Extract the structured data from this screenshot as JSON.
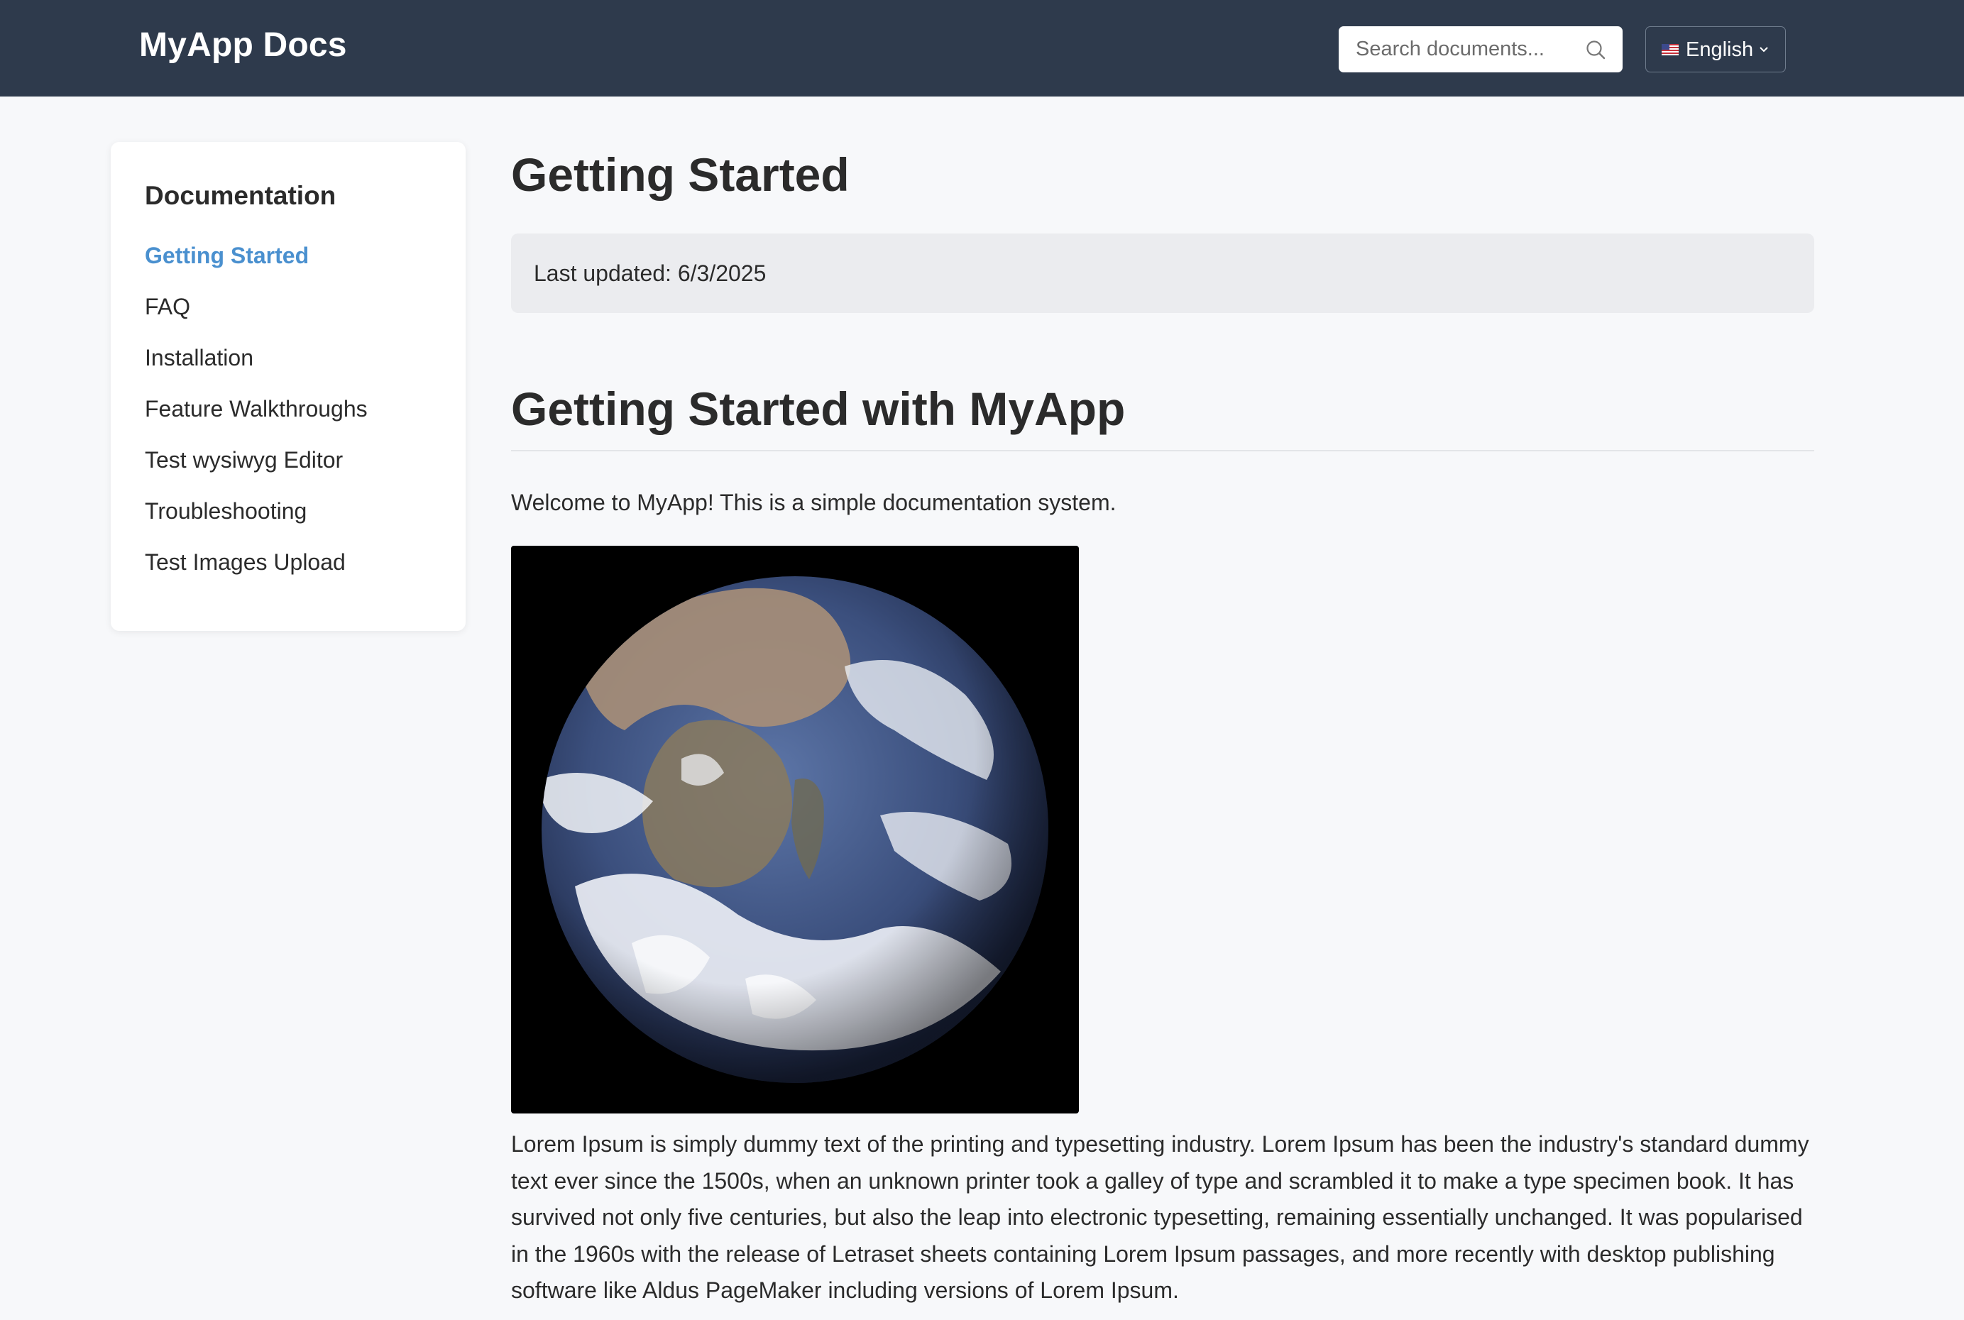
{
  "header": {
    "brand": "MyApp Docs",
    "search_placeholder": "Search documents...",
    "language": "English"
  },
  "sidebar": {
    "title": "Documentation",
    "items": [
      {
        "label": "Getting Started",
        "active": true
      },
      {
        "label": "FAQ"
      },
      {
        "label": "Installation"
      },
      {
        "label": "Feature Walkthroughs"
      },
      {
        "label": "Test wysiwyg Editor"
      },
      {
        "label": "Troubleshooting"
      },
      {
        "label": "Test Images Upload"
      }
    ]
  },
  "page": {
    "title": "Getting Started",
    "last_updated": "Last updated: 6/3/2025",
    "heading": "Getting Started with MyApp",
    "intro": "Welcome to MyApp! This is a simple documentation system.",
    "image": "earth-photo",
    "body": "Lorem Ipsum is simply dummy text of the printing and typesetting industry. Lorem Ipsum has been the industry's standard dummy text ever since the 1500s, when an unknown printer took a galley of type and scrambled it to make a type specimen book. It has survived not only five centuries, but also the leap into electronic typesetting, remaining essentially unchanged. It was popularised in the 1960s with the release of Letraset sheets containing Lorem Ipsum passages, and more recently with desktop publishing software like Aldus PageMaker including versions of Lorem Ipsum."
  },
  "colors": {
    "header_bg": "#2e3a4c",
    "page_bg": "#f7f8fa",
    "accent": "#4a90cf"
  },
  "icons": [
    "search-icon",
    "flag-us-icon",
    "chevron-down-icon"
  ]
}
